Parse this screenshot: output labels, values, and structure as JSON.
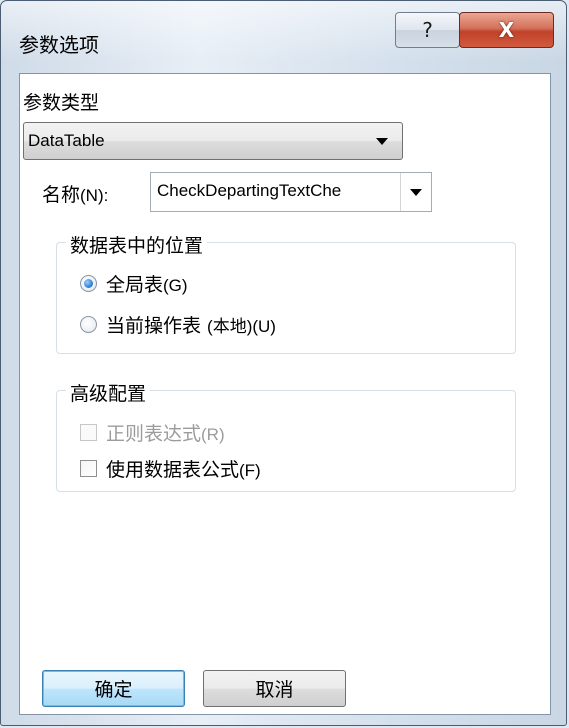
{
  "window": {
    "title": "参数选项",
    "help_glyph": "?",
    "close_glyph": "X"
  },
  "param_type": {
    "label": "参数类型",
    "value": "DataTable"
  },
  "name_field": {
    "label": "名称",
    "label_suffix": "(N):",
    "value": "CheckDepartingTextChe"
  },
  "location_group": {
    "title": "数据表中的位置",
    "options": [
      {
        "text": "全局表",
        "suffix": "(G)",
        "checked": true
      },
      {
        "text": "当前操作表 ",
        "suffix": "(本地)(U)",
        "checked": false
      }
    ]
  },
  "advanced_group": {
    "title": "高级配置",
    "options": [
      {
        "text": "正则表达式",
        "suffix": "(R)",
        "checked": false,
        "enabled": false
      },
      {
        "text": "使用数据表公式",
        "suffix": "(F)",
        "checked": false,
        "enabled": true
      }
    ]
  },
  "buttons": {
    "ok": "确定",
    "cancel": "取消"
  },
  "colors": {
    "accent": "#3a8be0",
    "close_button": "#c0412a"
  }
}
